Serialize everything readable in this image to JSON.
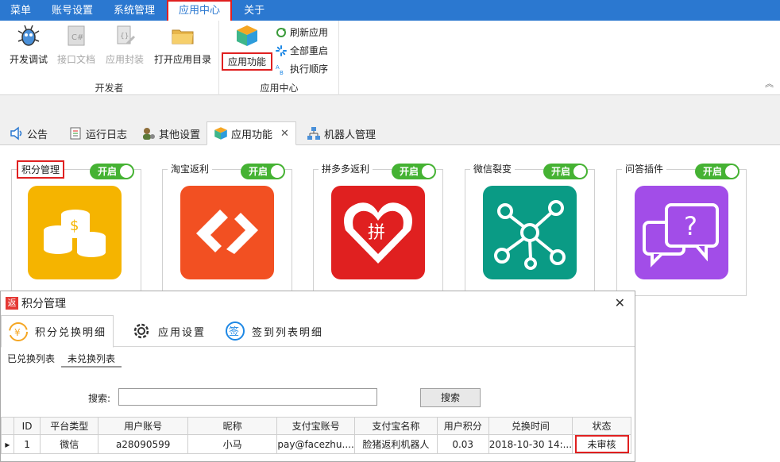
{
  "menubar": {
    "items": [
      "菜单",
      "账号设置",
      "系统管理",
      "应用中心",
      "关于"
    ],
    "active": "应用中心"
  },
  "ribbon": {
    "dev_group": {
      "label": "开发者",
      "buttons": [
        "开发调试",
        "接口文档",
        "应用封装",
        "打开应用目录"
      ]
    },
    "app_group": {
      "label": "应用中心",
      "main_button": "应用功能",
      "small_buttons": [
        "刷新应用",
        "全部重启",
        "执行顺序"
      ]
    }
  },
  "tabs": {
    "items": [
      "公告",
      "运行日志",
      "其他设置",
      "应用功能",
      "机器人管理"
    ],
    "active": "应用功能"
  },
  "cards": [
    {
      "title": "积分管理",
      "toggle": "开启",
      "color": "#f5b400"
    },
    {
      "title": "淘宝返利",
      "toggle": "开启",
      "color": "#f25022"
    },
    {
      "title": "拼多多返利",
      "toggle": "开启",
      "color": "#e02020"
    },
    {
      "title": "微信裂变",
      "toggle": "开启",
      "color": "#0a9b85"
    },
    {
      "title": "问答插件",
      "toggle": "开启",
      "color": "#a24de8"
    }
  ],
  "dialog": {
    "icon_text": "返",
    "title": "积分管理",
    "tabs": [
      "积分兑换明细",
      "应用设置",
      "签到列表明细"
    ],
    "subtabs": [
      "已兑换列表",
      "未兑换列表"
    ],
    "search_label": "搜索:",
    "search_value": "",
    "search_button": "搜索",
    "columns": [
      "ID",
      "平台类型",
      "用户账号",
      "昵称",
      "支付宝账号",
      "支付宝名称",
      "用户积分",
      "兑换时间",
      "状态"
    ],
    "rows": [
      [
        "1",
        "微信",
        "a28090599",
        "小马",
        "pay@facezhu....",
        "脸猪返利机器人",
        "0.03",
        "2018-10-30 14:...",
        "未审核"
      ]
    ]
  }
}
